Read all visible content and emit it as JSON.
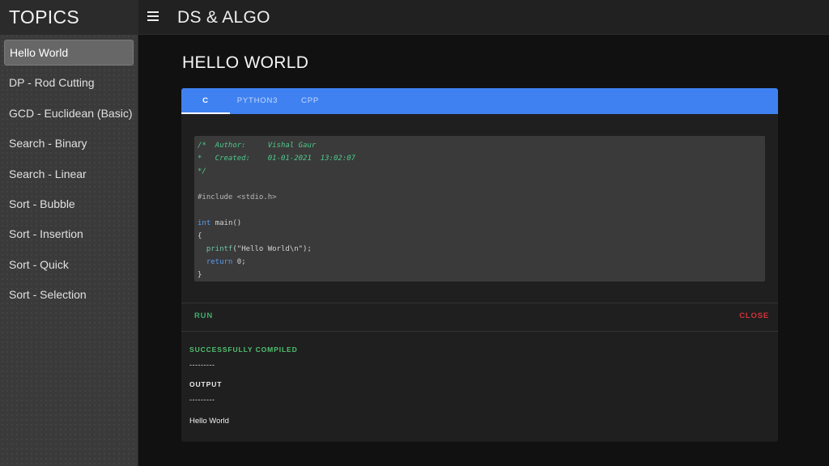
{
  "sidebar": {
    "title": "TOPICS",
    "items": [
      {
        "label": "Hello World"
      },
      {
        "label": "DP - Rod Cutting"
      },
      {
        "label": "GCD - Euclidean (Basic)"
      },
      {
        "label": "Search - Binary"
      },
      {
        "label": "Search - Linear"
      },
      {
        "label": "Sort - Bubble"
      },
      {
        "label": "Sort - Insertion"
      },
      {
        "label": "Sort - Quick"
      },
      {
        "label": "Sort - Selection"
      }
    ]
  },
  "topbar": {
    "menu_icon": "hamburger-menu-icon",
    "title": "DS & ALGO"
  },
  "main": {
    "title": "HELLO WORLD",
    "tabs": [
      {
        "label": "C"
      },
      {
        "label": "PYTHON3"
      },
      {
        "label": "CPP"
      }
    ],
    "code": {
      "comment1": "/*  Author:     Vishal Gaur",
      "comment2": "*   Created:    01-01-2021  13:02:07",
      "comment3": "*/",
      "include": "#include <stdio.h>",
      "kw_int": "int",
      "main_sig": " main()",
      "brace_open": "{",
      "fn_printf": "  printf",
      "printf_args": "(\"Hello World\\n\");",
      "kw_return": "  return",
      "return_val": " 0;",
      "brace_close": "}"
    },
    "actions": {
      "run_label": "RUN",
      "close_label": "CLOSE"
    },
    "output": {
      "status": "SUCCESSFULLY COMPILED",
      "separator1": "---------",
      "label": "OUTPUT",
      "separator2": "---------",
      "text": "Hello World"
    }
  },
  "colors": {
    "accent": "#3f81f0",
    "run": "#3fae6a",
    "close": "#d6323a",
    "success": "#4fc06f"
  }
}
